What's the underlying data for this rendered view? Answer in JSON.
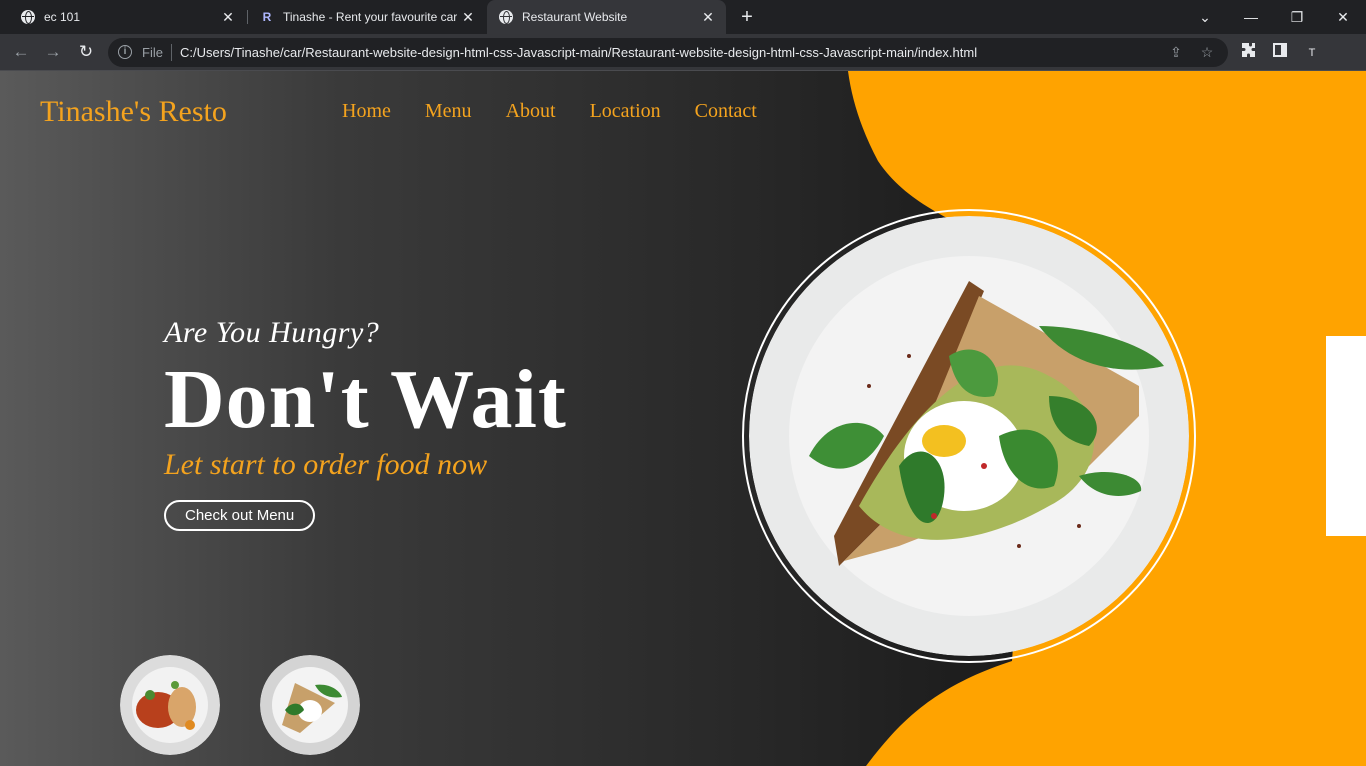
{
  "browser": {
    "tabs": [
      {
        "title": "ec 101",
        "icon": "globe-icon"
      },
      {
        "title": "Tinashe - Rent your favourite car",
        "icon": "r-favicon"
      },
      {
        "title": "Restaurant Website",
        "icon": "globe-icon",
        "active": true
      }
    ],
    "new_tab": "+",
    "file_label": "File",
    "url": "C:/Users/Tinashe/car/Restaurant-website-design-html-css-Javascript-main/Restaurant-website-design-html-css-Javascript-main/index.html",
    "profile_initial": "T"
  },
  "site": {
    "logo": "Tinashe's Resto",
    "nav": [
      "Home",
      "Menu",
      "About",
      "Location",
      "Contact"
    ],
    "hero": {
      "subtitle": "Are You Hungry?",
      "title": "Don't Wait",
      "tagline": "Let start to order food now",
      "button": "Check out Menu"
    },
    "colors": {
      "accent": "#f4a31e",
      "orange_shape": "#ffa300",
      "text": "#ffffff",
      "background": "#2b2b2b"
    }
  }
}
